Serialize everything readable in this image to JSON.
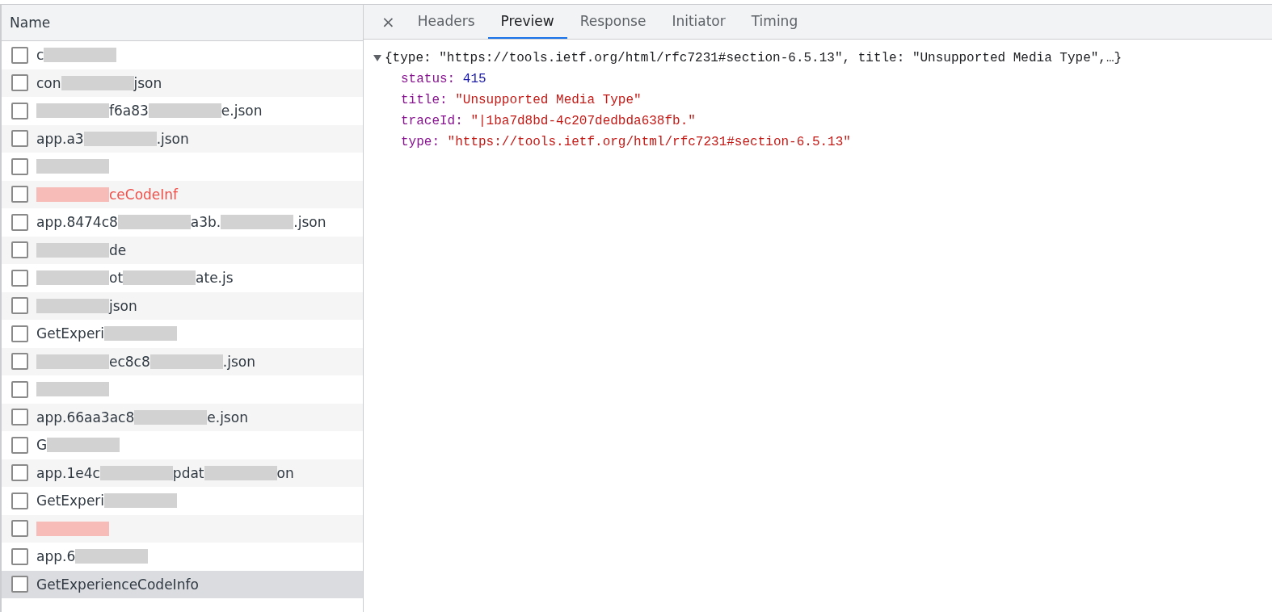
{
  "requests": {
    "column": "Name",
    "rows": [
      {
        "selected": false,
        "error": false,
        "segments": [
          {
            "kind": "text",
            "text": "c"
          },
          {
            "kind": "blur"
          }
        ]
      },
      {
        "selected": false,
        "error": false,
        "segments": [
          {
            "kind": "text",
            "text": "con"
          },
          {
            "kind": "blur"
          },
          {
            "kind": "text",
            "text": "json"
          }
        ]
      },
      {
        "selected": false,
        "error": false,
        "segments": [
          {
            "kind": "blur"
          },
          {
            "kind": "text",
            "text": "f6a83"
          },
          {
            "kind": "blur"
          },
          {
            "kind": "text",
            "text": "e.json"
          }
        ]
      },
      {
        "selected": false,
        "error": false,
        "segments": [
          {
            "kind": "text",
            "text": "app.a3"
          },
          {
            "kind": "blur"
          },
          {
            "kind": "text",
            "text": ".json"
          }
        ]
      },
      {
        "selected": false,
        "error": false,
        "segments": [
          {
            "kind": "blur"
          }
        ]
      },
      {
        "selected": false,
        "error": true,
        "segments": [
          {
            "kind": "blur"
          },
          {
            "kind": "text",
            "text": "ceCodeInf"
          }
        ]
      },
      {
        "selected": false,
        "error": false,
        "segments": [
          {
            "kind": "text",
            "text": "app.8474c8"
          },
          {
            "kind": "blur"
          },
          {
            "kind": "text",
            "text": "a3b."
          },
          {
            "kind": "blur"
          },
          {
            "kind": "text",
            "text": ".json"
          }
        ]
      },
      {
        "selected": false,
        "error": false,
        "segments": [
          {
            "kind": "blur"
          },
          {
            "kind": "text",
            "text": "de"
          }
        ]
      },
      {
        "selected": false,
        "error": false,
        "segments": [
          {
            "kind": "blur"
          },
          {
            "kind": "text",
            "text": "ot"
          },
          {
            "kind": "blur"
          },
          {
            "kind": "text",
            "text": "ate.js"
          }
        ]
      },
      {
        "selected": false,
        "error": false,
        "segments": [
          {
            "kind": "blur"
          },
          {
            "kind": "text",
            "text": "json"
          }
        ]
      },
      {
        "selected": false,
        "error": false,
        "segments": [
          {
            "kind": "text",
            "text": "GetExperi"
          },
          {
            "kind": "blur"
          }
        ]
      },
      {
        "selected": false,
        "error": false,
        "segments": [
          {
            "kind": "blur"
          },
          {
            "kind": "text",
            "text": "ec8c8"
          },
          {
            "kind": "blur"
          },
          {
            "kind": "text",
            "text": ".json"
          }
        ]
      },
      {
        "selected": false,
        "error": false,
        "segments": [
          {
            "kind": "blur"
          }
        ]
      },
      {
        "selected": false,
        "error": false,
        "segments": [
          {
            "kind": "text",
            "text": "app.66aa3ac8"
          },
          {
            "kind": "blur"
          },
          {
            "kind": "text",
            "text": "e.json"
          }
        ]
      },
      {
        "selected": false,
        "error": false,
        "segments": [
          {
            "kind": "text",
            "text": "G"
          },
          {
            "kind": "blur"
          }
        ]
      },
      {
        "selected": false,
        "error": false,
        "segments": [
          {
            "kind": "text",
            "text": "app.1e4c"
          },
          {
            "kind": "blur"
          },
          {
            "kind": "text",
            "text": "pdat"
          },
          {
            "kind": "blur"
          },
          {
            "kind": "text",
            "text": "on"
          }
        ]
      },
      {
        "selected": false,
        "error": false,
        "segments": [
          {
            "kind": "text",
            "text": "GetExperi"
          },
          {
            "kind": "blur"
          }
        ]
      },
      {
        "selected": false,
        "error": true,
        "segments": [
          {
            "kind": "blur"
          }
        ]
      },
      {
        "selected": false,
        "error": false,
        "segments": [
          {
            "kind": "text",
            "text": "app.6"
          },
          {
            "kind": "blur"
          }
        ]
      },
      {
        "selected": true,
        "error": false,
        "segments": [
          {
            "kind": "text",
            "text": "GetExperienceCodeInfo"
          }
        ]
      }
    ]
  },
  "details": {
    "close": "×",
    "tabs": [
      {
        "label": "Headers",
        "selected": false
      },
      {
        "label": "Preview",
        "selected": true
      },
      {
        "label": "Response",
        "selected": false
      },
      {
        "label": "Initiator",
        "selected": false
      },
      {
        "label": "Timing",
        "selected": false
      }
    ],
    "preview": {
      "expanded": true,
      "summary": "{type: \"https://tools.ietf.org/html/rfc7231#section-6.5.13\", title: \"Unsupported Media Type\",…}",
      "properties": [
        {
          "key": "status:",
          "value": "415",
          "kind": "number"
        },
        {
          "key": "title:",
          "value": "\"Unsupported Media Type\"",
          "kind": "string"
        },
        {
          "key": "traceId:",
          "value": "\"|1ba7d8bd-4c207dedbda638fb.\"",
          "kind": "string"
        },
        {
          "key": "type:",
          "value": "\"https://tools.ietf.org/html/rfc7231#section-6.5.13\"",
          "kind": "string"
        }
      ]
    }
  }
}
